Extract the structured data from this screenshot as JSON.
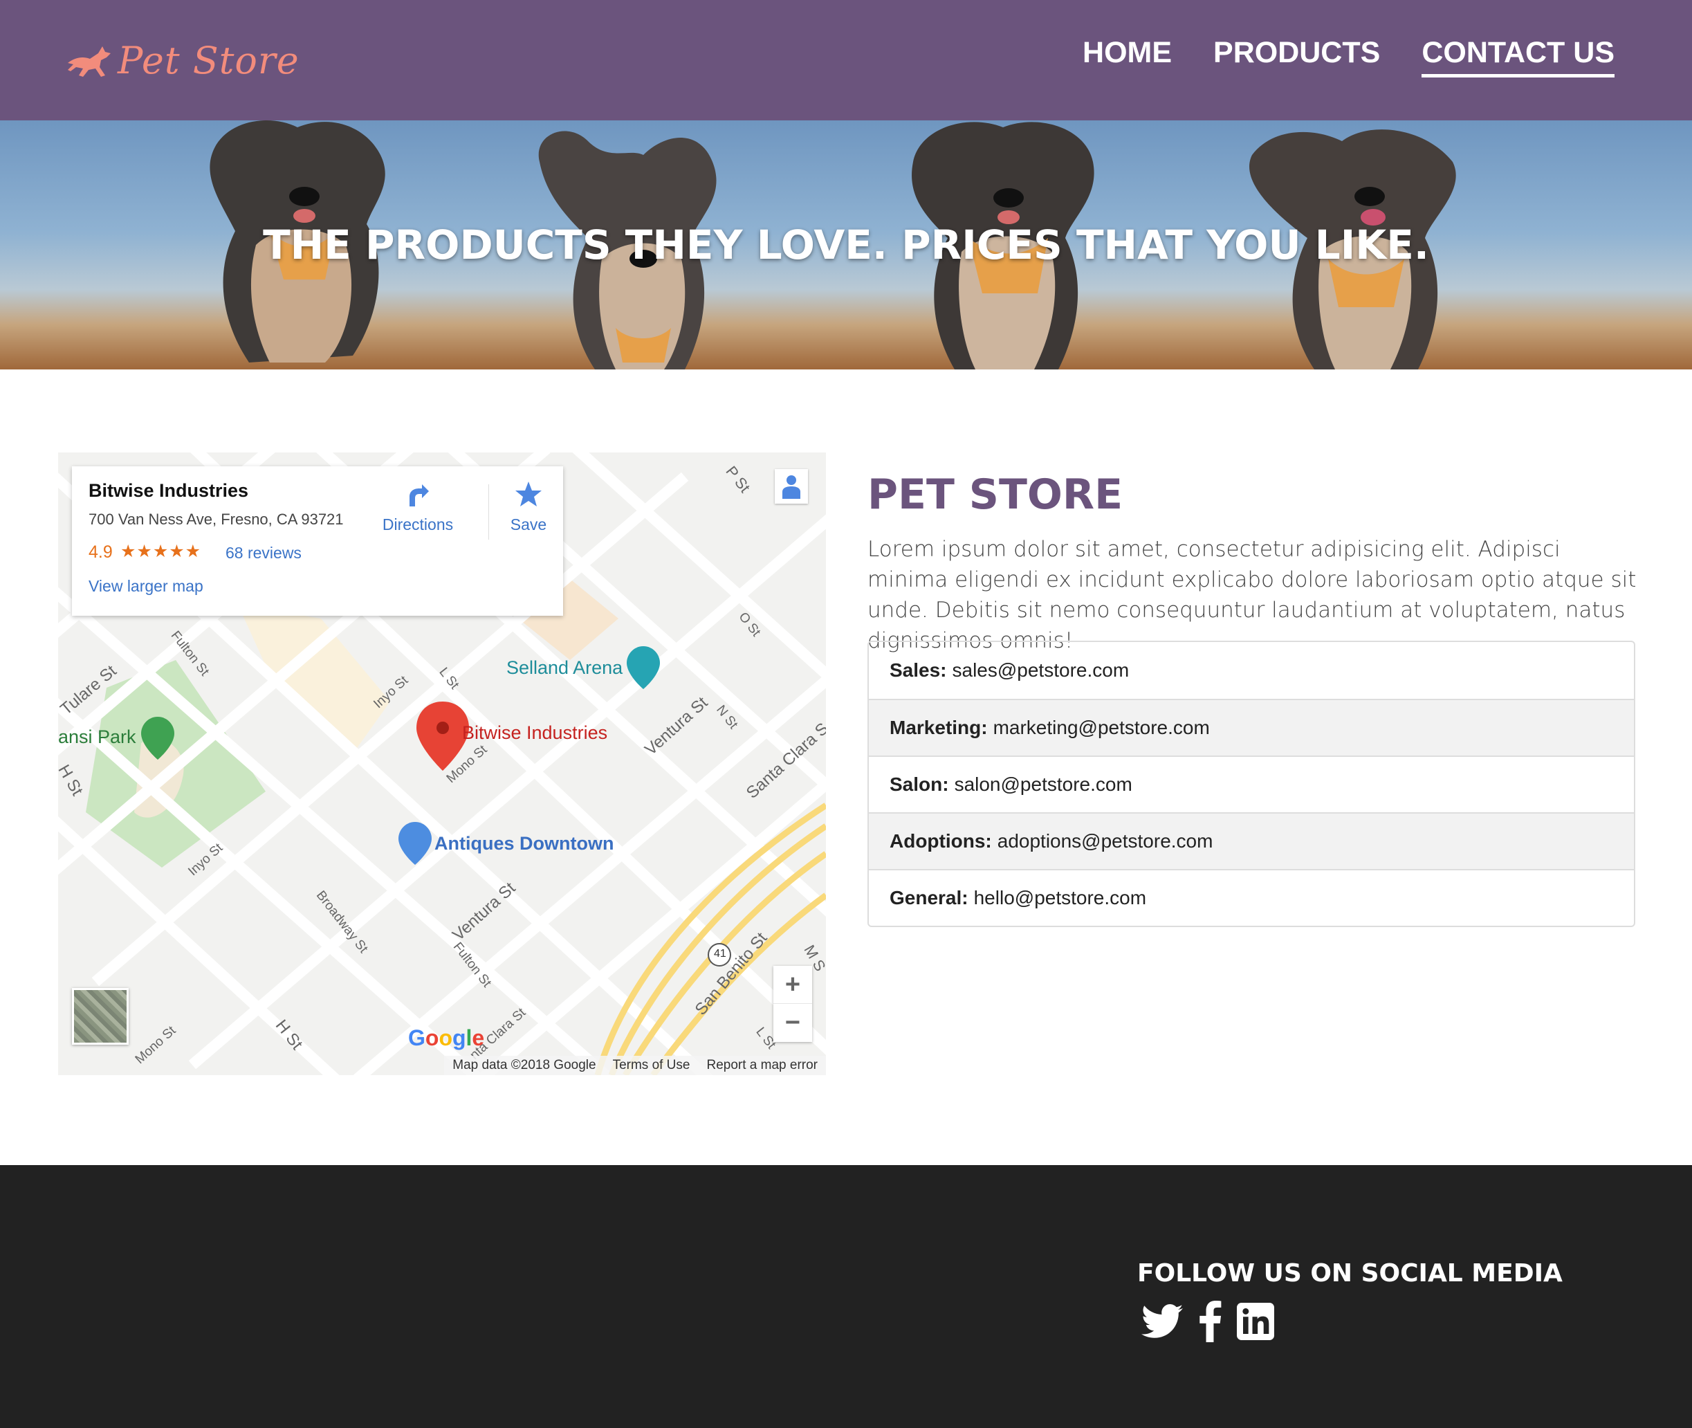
{
  "nav": {
    "brand": "Pet Store",
    "links": [
      "HOME",
      "PRODUCTS",
      "CONTACT US"
    ],
    "active": "CONTACT US"
  },
  "hero": {
    "headline": "THE PRODUCTS THEY LOVE. PRICES THAT YOU LIKE."
  },
  "map": {
    "place_name": "Bitwise Industries",
    "address": "700 Van Ness Ave, Fresno, CA 93721",
    "rating": "4.9",
    "stars": "★★★★★",
    "reviews": "68 reviews",
    "larger_map": "View larger map",
    "directions": "Directions",
    "save": "Save",
    "zoom_in": "+",
    "zoom_out": "−",
    "footer": {
      "data": "Map data ©2018 Google",
      "terms": "Terms of Use",
      "report": "Report a map error"
    },
    "pois": {
      "arena": "Selland Arena",
      "pin": "Bitwise Industries",
      "park": "ansi Park",
      "antiques": "Antiques Downtown"
    },
    "streets": {
      "tulare": "Tulare St",
      "fulton1": "Fulton St",
      "inyo1": "Inyo St",
      "l": "L St",
      "mono1": "Mono St",
      "ventura1": "Ventura St",
      "n": "N St",
      "santaclara1": "Santa Clara S",
      "o": "O St",
      "p": "P St",
      "h1": "H St",
      "inyo2": "Inyo St",
      "broadway": "Broadway St",
      "ventura2": "Ventura St",
      "fulton2": "Fulton St",
      "santaclara2": "nta Clara St",
      "sanbenito": "San Benito St",
      "h2": "H St",
      "mono2": "Mono St",
      "l2": "L St",
      "hw": "41",
      "ms": "M S"
    },
    "google": "Google"
  },
  "store": {
    "title": "PET STORE",
    "description": "Lorem ipsum dolor sit amet, consectetur adipisicing elit. Adipisci minima eligendi ex incidunt explicabo dolore laboriosam optio atque sit unde. Debitis sit nemo consequuntur laudantium at voluptatem, natus dignissimos omnis!"
  },
  "contacts": [
    {
      "label": "Sales:",
      "email": "sales@petstore.com"
    },
    {
      "label": "Marketing:",
      "email": "marketing@petstore.com"
    },
    {
      "label": "Salon:",
      "email": "salon@petstore.com"
    },
    {
      "label": "Adoptions:",
      "email": "adoptions@petstore.com"
    },
    {
      "label": "General:",
      "email": "hello@petstore.com"
    }
  ],
  "footer": {
    "follow": "FOLLOW US ON SOCIAL MEDIA",
    "socials": [
      "twitter-icon",
      "facebook-icon",
      "linkedin-icon"
    ]
  },
  "colors": {
    "nav_bg": "#6b547d",
    "brand": "#f28c7c",
    "title": "#6b547d",
    "footer_bg": "#222222",
    "link": "#3a73c7",
    "rating": "#e7711b"
  }
}
